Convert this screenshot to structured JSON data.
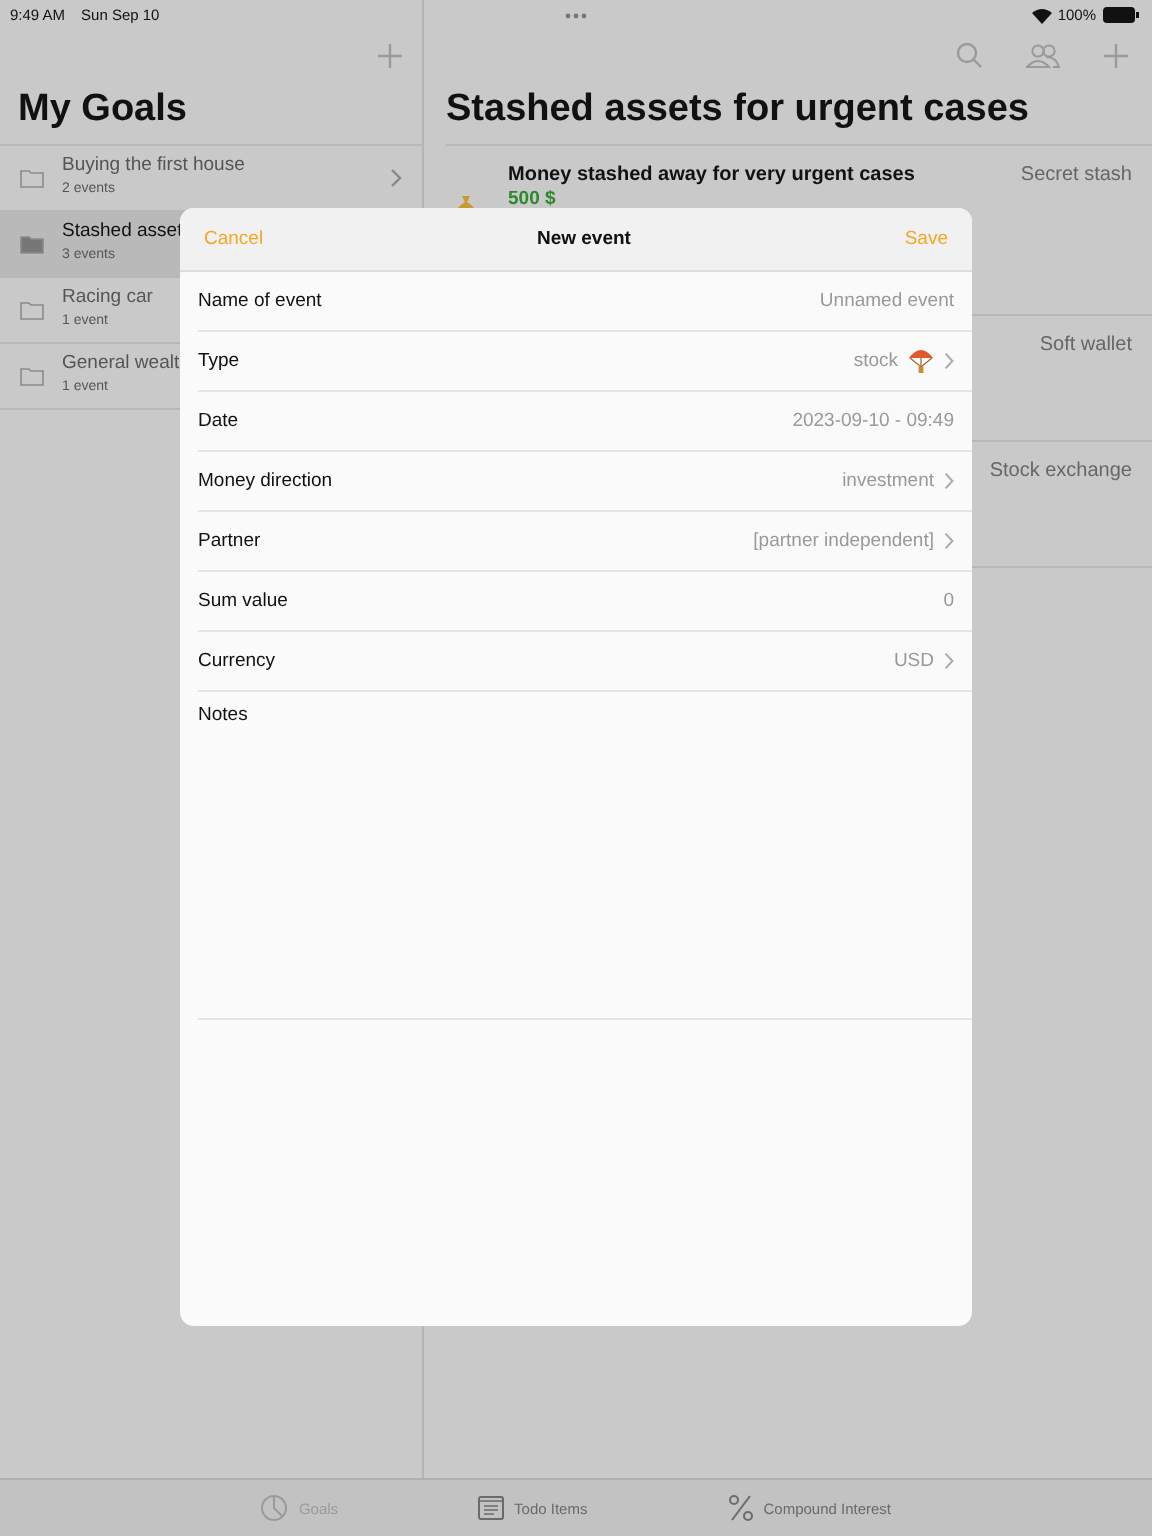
{
  "status_bar": {
    "time": "9:49 AM",
    "date": "Sun Sep 10",
    "battery": "100%"
  },
  "sidebar": {
    "title": "My Goals",
    "items": [
      {
        "name": "Buying the first house",
        "count": "2 events",
        "selected": false,
        "chevron": true
      },
      {
        "name": "Stashed asset",
        "count": "3 events",
        "selected": true
      },
      {
        "name": "Racing car",
        "count": "1 event",
        "selected": false
      },
      {
        "name": "General wealt",
        "count": "1 event",
        "selected": false
      }
    ]
  },
  "detail": {
    "title": "Stashed assets for urgent cases",
    "rows": [
      {
        "title": "Money stashed away for very urgent cases",
        "amount": "500 $",
        "category": "Secret stash"
      },
      {
        "category": "Soft wallet"
      },
      {
        "category": "Stock exchange"
      }
    ]
  },
  "modal": {
    "title": "New event",
    "cancel": "Cancel",
    "save": "Save",
    "fields": [
      {
        "kind": "text",
        "label": "Name of event",
        "placeholder": "Unnamed event"
      },
      {
        "kind": "type",
        "label": "Type",
        "value": "stock"
      },
      {
        "kind": "date",
        "label": "Date",
        "value": "2023-09-10 - 09:49"
      },
      {
        "kind": "picker",
        "label": "Money direction",
        "value": "investment"
      },
      {
        "kind": "picker",
        "label": "Partner",
        "value": "[partner independent]"
      },
      {
        "kind": "text",
        "label": "Sum value",
        "placeholder": "0"
      },
      {
        "kind": "picker",
        "label": "Currency",
        "value": "USD"
      }
    ],
    "notes_label": "Notes"
  },
  "tabs": [
    {
      "label": "Goals",
      "kind": "chart",
      "selected": true
    },
    {
      "label": "Todo Items",
      "kind": "list",
      "selected": false
    },
    {
      "label": "Compound Interest",
      "kind": "percent",
      "selected": false
    }
  ]
}
